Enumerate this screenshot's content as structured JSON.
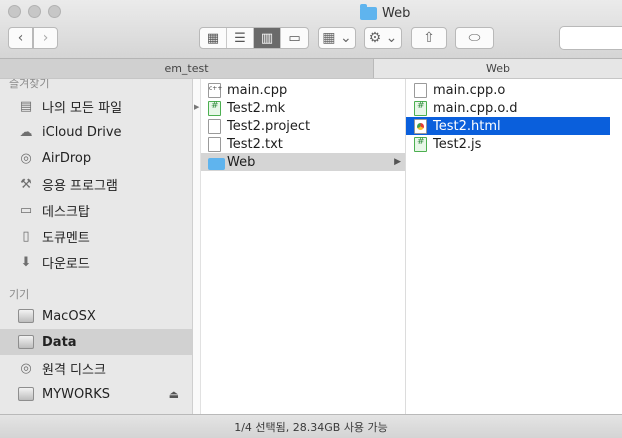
{
  "window": {
    "title": "Web"
  },
  "toolbar": {
    "back_icon": "‹",
    "forward_icon": "›",
    "view_icons": [
      "▦",
      "☰",
      "▥",
      "▭"
    ],
    "arrange_icon": "▦ ⌄",
    "action_icon": "⚙ ⌄",
    "share_icon": "⇧",
    "tag_icon": "⬭"
  },
  "pathbar": {
    "left": "em_test",
    "right": "Web"
  },
  "sidebar": {
    "header_favorites": "즐겨찾기",
    "favorites": [
      {
        "label": "나의 모든 파일",
        "icon": "▤"
      },
      {
        "label": "iCloud Drive",
        "icon": "☁"
      },
      {
        "label": "AirDrop",
        "icon": "◎"
      },
      {
        "label": "응용 프로그램",
        "icon": "⚒"
      },
      {
        "label": "데스크탑",
        "icon": "▭"
      },
      {
        "label": "도큐멘트",
        "icon": "▯"
      },
      {
        "label": "다운로드",
        "icon": "⬇"
      }
    ],
    "header_devices": "기기",
    "devices": [
      {
        "label": "MacOSX"
      },
      {
        "label": "Data"
      },
      {
        "label": "원격 디스크"
      },
      {
        "label": "MYWORKS",
        "eject": "⏏"
      }
    ]
  },
  "columns": {
    "col1": [
      {
        "name": "main.cpp",
        "icon": "cpp"
      },
      {
        "name": "Test2.mk",
        "icon": "g"
      },
      {
        "name": "Test2.project",
        "icon": "doc"
      },
      {
        "name": "Test2.txt",
        "icon": "doc"
      },
      {
        "name": "Web",
        "icon": "folder",
        "arrow": "▶"
      }
    ],
    "col2": [
      {
        "name": "main.cpp.o",
        "icon": "doc"
      },
      {
        "name": "main.cpp.o.d",
        "icon": "g"
      },
      {
        "name": "Test2.html",
        "icon": "html"
      },
      {
        "name": "Test2.js",
        "icon": "g"
      }
    ]
  },
  "status": {
    "text": "1/4 선택됨, 28.34GB 사용 가능"
  }
}
